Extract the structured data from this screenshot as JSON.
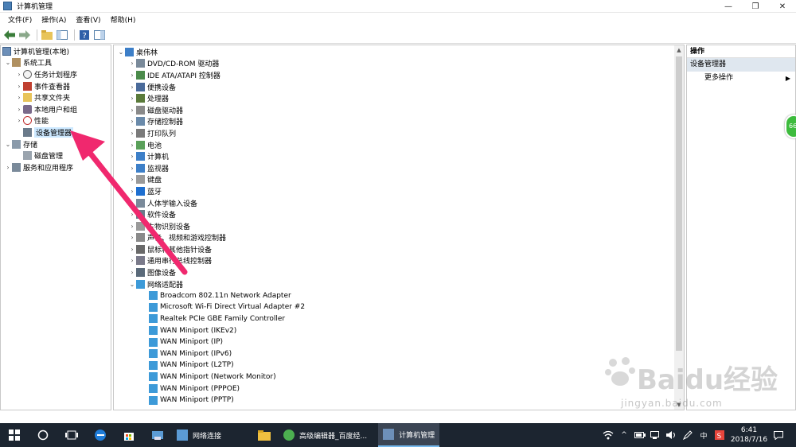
{
  "window": {
    "title": "计算机管理"
  },
  "menu": [
    "文件(F)",
    "操作(A)",
    "查看(V)",
    "帮助(H)"
  ],
  "left_tree": {
    "root": "计算机管理(本地)",
    "items": [
      {
        "label": "系统工具",
        "level": 1,
        "expanded": true
      },
      {
        "label": "任务计划程序",
        "level": 2
      },
      {
        "label": "事件查看器",
        "level": 2
      },
      {
        "label": "共享文件夹",
        "level": 2
      },
      {
        "label": "本地用户和组",
        "level": 2
      },
      {
        "label": "性能",
        "level": 2
      },
      {
        "label": "设备管理器",
        "level": 2,
        "selected": true
      },
      {
        "label": "存储",
        "level": 1,
        "expanded": true
      },
      {
        "label": "磁盘管理",
        "level": 2
      },
      {
        "label": "服务和应用程序",
        "level": 1
      }
    ]
  },
  "device_tree": {
    "root": "桌伟林",
    "categories": [
      "DVD/CD-ROM 驱动器",
      "IDE ATA/ATAPI 控制器",
      "便携设备",
      "处理器",
      "磁盘驱动器",
      "存储控制器",
      "打印队列",
      "电池",
      "计算机",
      "监视器",
      "键盘",
      "蓝牙",
      "人体学输入设备",
      "软件设备",
      "生物识别设备",
      "声音、视频和游戏控制器",
      "鼠标和其他指针设备",
      "通用串行总线控制器",
      "图像设备"
    ],
    "expanded_category": "网络适配器",
    "network_adapters": [
      "Broadcom 802.11n Network Adapter",
      "Microsoft Wi-Fi Direct Virtual Adapter #2",
      "Realtek PCIe GBE Family Controller",
      "WAN Miniport (IKEv2)",
      "WAN Miniport (IP)",
      "WAN Miniport (IPv6)",
      "WAN Miniport (L2TP)",
      "WAN Miniport (Network Monitor)",
      "WAN Miniport (PPPOE)",
      "WAN Miniport (PPTP)"
    ]
  },
  "actions": {
    "header": "操作",
    "section": "设备管理器",
    "more": "更多操作"
  },
  "float_badge": "66",
  "watermark": {
    "brand": "Baidu经验",
    "url": "jingyan.baidu.com"
  },
  "taskbar": {
    "items": [
      {
        "label": "网络连接",
        "active": false
      },
      {
        "label": "高级编辑器_百度经...",
        "active": false
      },
      {
        "label": "计算机管理",
        "active": true
      }
    ],
    "ime": "中",
    "time": "6:41",
    "date": "2018/7/16"
  },
  "colors": {
    "accent_arrow": "#f0286e",
    "taskbar": "#1c2530",
    "selection": "#cce8ff"
  }
}
